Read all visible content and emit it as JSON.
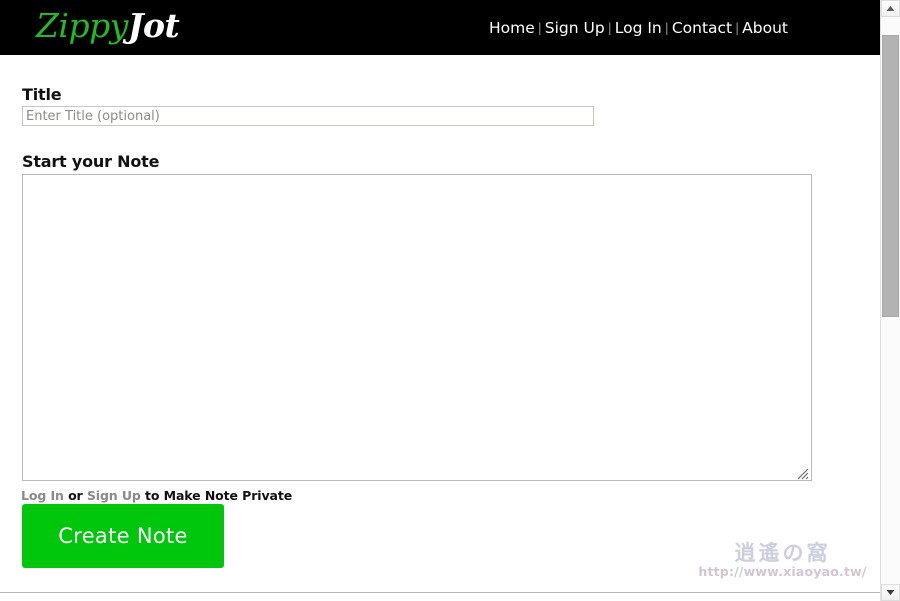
{
  "header": {
    "logo": {
      "part1": "Zippy",
      "part2": "Jot"
    },
    "nav": {
      "separator": "|",
      "items": [
        {
          "label": "Home",
          "name": "nav-home"
        },
        {
          "label": "Sign Up",
          "name": "nav-sign-up"
        },
        {
          "label": "Log In",
          "name": "nav-log-in"
        },
        {
          "label": "Contact",
          "name": "nav-contact"
        },
        {
          "label": "About",
          "name": "nav-about"
        }
      ]
    }
  },
  "form": {
    "title_label": "Title",
    "title_placeholder": "Enter Title (optional)",
    "title_value": "",
    "note_label": "Start your Note",
    "note_placeholder": "",
    "note_value": "",
    "privacy": {
      "login_link": "Log In",
      "middle": " or ",
      "signup_link": "Sign Up",
      "suffix": " to Make Note Private"
    },
    "submit_label": "Create Note"
  },
  "watermark": {
    "text": "逍遙の窩",
    "url": "http://www.xiaoyao.tw/"
  },
  "scrollbar": {
    "up_arrow": "▲",
    "down_arrow": "▼"
  },
  "colors": {
    "header_bg": "#000000",
    "logo_green": "#22bb22",
    "button_green": "#00c70c",
    "link_grey": "#8a8a8a"
  }
}
